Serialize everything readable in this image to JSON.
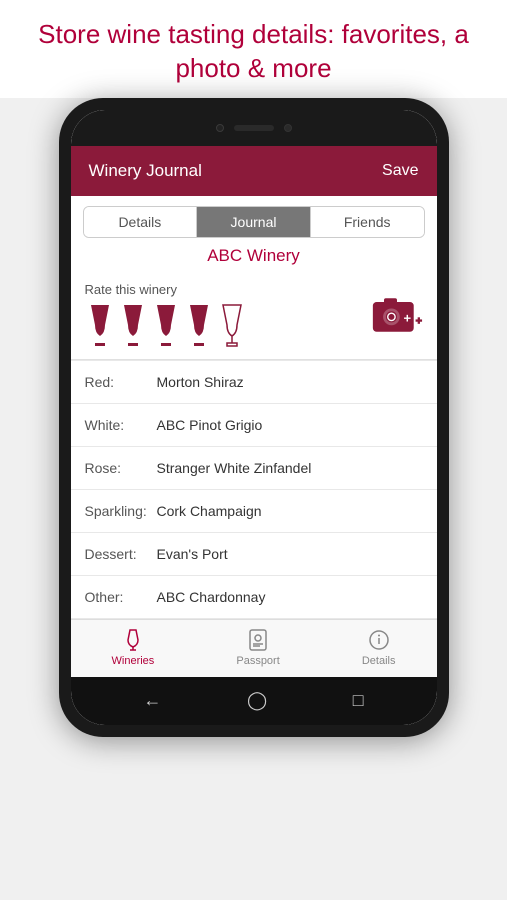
{
  "banner": {
    "text": "Store wine tasting details: favorites, a photo & more"
  },
  "header": {
    "title": "Winery Journal",
    "save_label": "Save"
  },
  "tabs": [
    {
      "id": "details",
      "label": "Details",
      "active": false
    },
    {
      "id": "journal",
      "label": "Journal",
      "active": true
    },
    {
      "id": "friends",
      "label": "Friends",
      "active": false
    }
  ],
  "winery_name": "ABC Winery",
  "rating": {
    "label": "Rate this winery",
    "filled_glasses": 4,
    "total_glasses": 5
  },
  "wine_entries": [
    {
      "label": "Red:",
      "value": "Morton Shiraz"
    },
    {
      "label": "White:",
      "value": "ABC Pinot Grigio"
    },
    {
      "label": "Rose:",
      "value": "Stranger White Zinfandel"
    },
    {
      "label": "Sparkling:",
      "value": "Cork Champaign"
    },
    {
      "label": "Dessert:",
      "value": "Evan's Port"
    },
    {
      "label": "Other:",
      "value": "ABC Chardonnay"
    }
  ],
  "bottom_nav": [
    {
      "id": "wineries",
      "label": "Wineries",
      "active": true
    },
    {
      "id": "passport",
      "label": "Passport",
      "active": false
    },
    {
      "id": "details-nav",
      "label": "Details",
      "active": false
    }
  ],
  "colors": {
    "brand": "#8b1a3a",
    "accent": "#b0003a",
    "active_tab_bg": "#777777"
  }
}
